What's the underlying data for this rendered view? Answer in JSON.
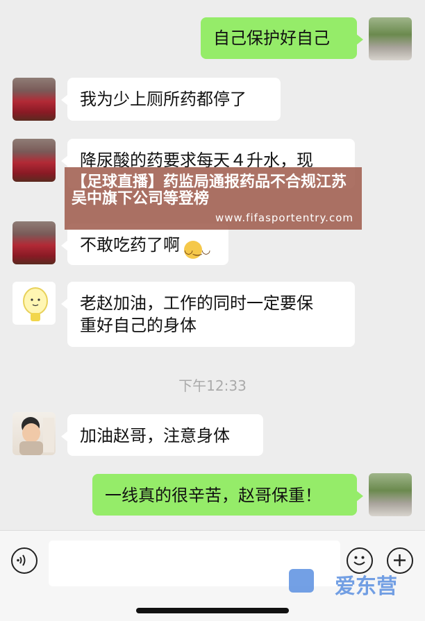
{
  "messages": [
    {
      "side": "right",
      "text": "自己保护好自己"
    },
    {
      "side": "left",
      "text": "我为少上厕所药都停了"
    },
    {
      "side": "left",
      "text": "降尿酸的药要求每天４升水，现"
    },
    {
      "side": "left",
      "text": "不敢吃药了啊"
    },
    {
      "side": "left",
      "line1": "老赵加油，工作的同时一定要保",
      "line2": "重好自己的身体"
    },
    {
      "side": "left",
      "text": "加油赵哥，注意身体"
    },
    {
      "side": "right",
      "text": "一线真的很辛苦，赵哥保重！"
    }
  ],
  "timestamp": "下午12:33",
  "banner": {
    "title": "【足球直播】药监局通报药品不合规江苏吴中旗下公司等登榜",
    "url": "www.fifasportentry.com"
  },
  "watermark": {
    "text": "爱东营",
    "logo_text": "爱东营"
  },
  "colors": {
    "right_bubble": "#95ec69",
    "left_bubble": "#ffffff",
    "background": "#ededed"
  },
  "icons": [
    "voice-icon",
    "emoji-icon",
    "plus-icon"
  ]
}
